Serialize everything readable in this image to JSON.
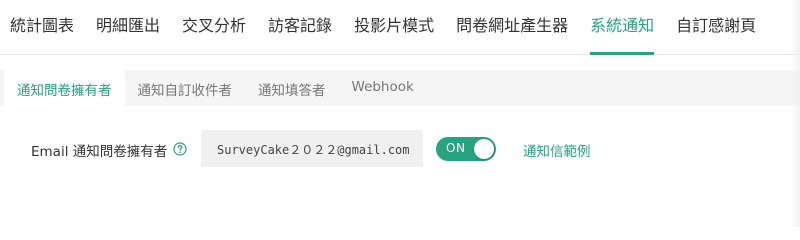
{
  "colors": {
    "accent": "#25a480",
    "text": "#333333",
    "muted": "#777777",
    "tab_bar_bg": "#f5f5f5",
    "input_bg": "#f0f0f0"
  },
  "topnav": {
    "items": [
      {
        "label": "統計圖表",
        "active": false
      },
      {
        "label": "明細匯出",
        "active": false
      },
      {
        "label": "交叉分析",
        "active": false
      },
      {
        "label": "訪客記錄",
        "active": false
      },
      {
        "label": "投影片模式",
        "active": false
      },
      {
        "label": "問卷網址產生器",
        "active": false
      },
      {
        "label": "系統通知",
        "active": true
      },
      {
        "label": "自訂感謝頁",
        "active": false
      }
    ]
  },
  "subtabs": {
    "items": [
      {
        "label": "通知問卷擁有者",
        "active": true
      },
      {
        "label": "通知自訂收件者",
        "active": false
      },
      {
        "label": "通知填答者",
        "active": false
      },
      {
        "label": "Webhook",
        "active": false
      }
    ]
  },
  "owner_notification": {
    "label": "Email 通知問卷擁有者",
    "help_icon": "question-circle-icon",
    "email": "SurveyCake２０２２@gmail.com",
    "toggle_label": "ON",
    "toggle_on": true,
    "example_link": "通知信範例"
  }
}
